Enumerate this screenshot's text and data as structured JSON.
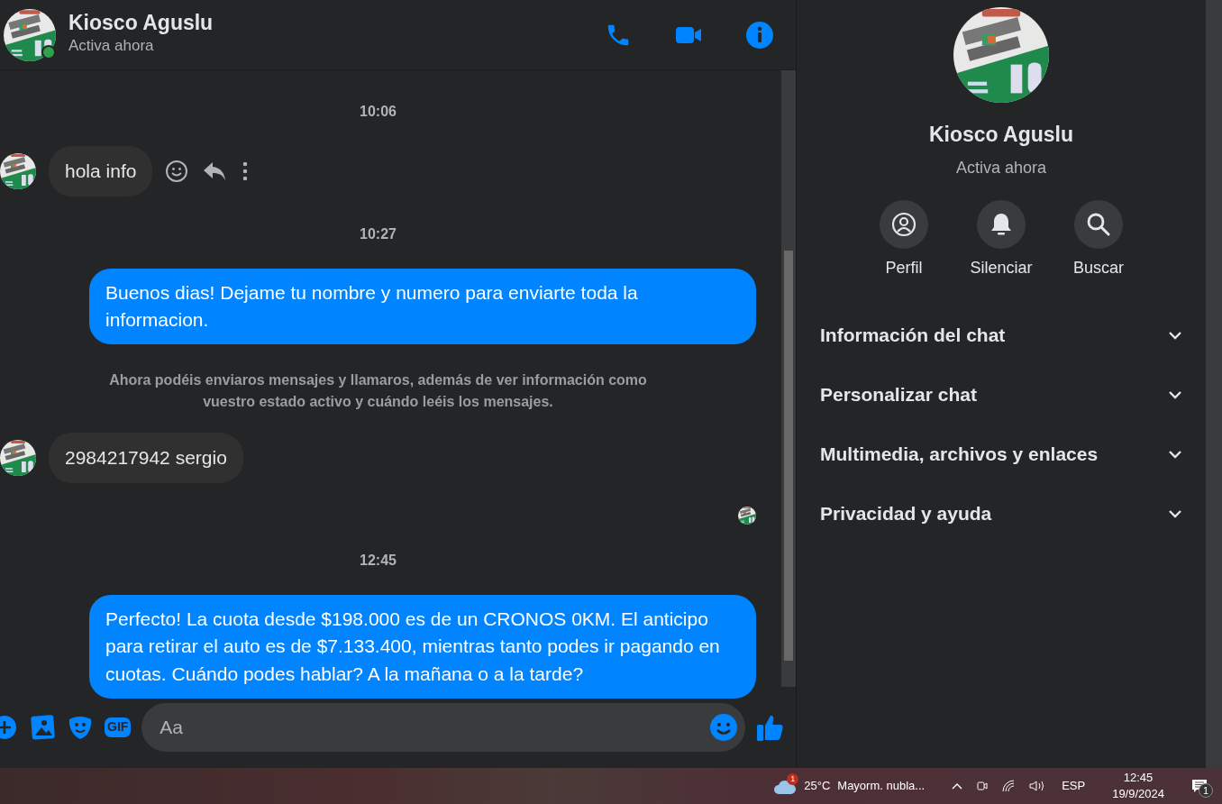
{
  "header": {
    "name": "Kiosco Aguslu",
    "status": "Activa ahora",
    "online": true
  },
  "messages": [
    {
      "kind": "time",
      "text": "10:06"
    },
    {
      "kind": "incoming",
      "text": "hola info",
      "actions": [
        {
          "kind": "react"
        },
        {
          "kind": "reply"
        },
        {
          "kind": "more"
        }
      ]
    },
    {
      "kind": "time",
      "text": "10:27"
    },
    {
      "kind": "outgoing",
      "text": "Buenos dias! Dejame tu nombre y numero para enviarte toda la informacion."
    },
    {
      "kind": "system",
      "text": "Ahora podéis enviaros mensajes y llamaros, además de ver información como vuestro estado activo y cuándo leéis los mensajes."
    },
    {
      "kind": "incoming",
      "text": "2984217942 sergio"
    },
    {
      "kind": "seen"
    },
    {
      "kind": "time",
      "text": "12:45"
    },
    {
      "kind": "outgoing",
      "text": "Perfecto! La cuota desde $198.000 es de un CRONOS 0KM. El anticipo para retirar el auto es de $7.133.400, mientras tanto podes ir pagando en cuotas. Cuándo podes hablar? A la mañana o a la tarde?"
    }
  ],
  "composer": {
    "gif_label": "GIF",
    "placeholder": "Aa"
  },
  "profile": {
    "name": "Kiosco Aguslu",
    "status": "Activa ahora",
    "actions": [
      {
        "kind": "profile",
        "label": "Perfil"
      },
      {
        "kind": "mute",
        "label": "Silenciar"
      },
      {
        "kind": "search",
        "label": "Buscar"
      }
    ],
    "sections": [
      {
        "label": "Información del chat",
        "expanded": false
      },
      {
        "label": "Personalizar chat",
        "expanded": false
      },
      {
        "label": "Multimedia, archivos y enlaces",
        "expanded": false
      },
      {
        "label": "Privacidad y ayuda",
        "expanded": false
      }
    ]
  },
  "taskbar": {
    "weather_badge": "1",
    "temperature": "25°C",
    "weather": "Mayorm. nubla...",
    "language": "ESP",
    "time": "12:45",
    "date": "19/9/2024",
    "notification_badge": "1"
  }
}
